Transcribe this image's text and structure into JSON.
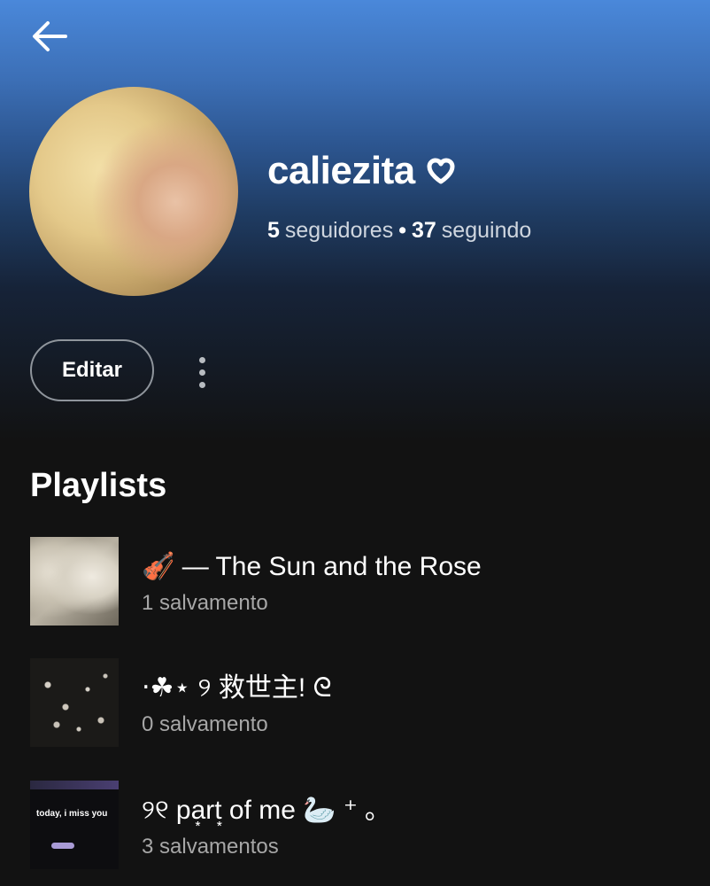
{
  "profile": {
    "name": "caliezita",
    "followers_count": "5",
    "followers_label": "seguidores",
    "separator": "•",
    "following_count": "37",
    "following_label": "seguindo"
  },
  "actions": {
    "edit_label": "Editar"
  },
  "playlists": {
    "section_title": "Playlists",
    "items": [
      {
        "title": "🎻 — The Sun and the Rose",
        "subtitle": "1 salvamento",
        "cover_text": ""
      },
      {
        "title": "‧☘︎⋆ ୨  救世主!  ᘓ",
        "subtitle": "0 salvamento",
        "cover_text": ""
      },
      {
        "title": "୨୧  pa͙rt͙ of me  🦢 ⁺ ｡",
        "subtitle": "3 salvamentos",
        "cover_text": "today, i miss you"
      }
    ]
  },
  "colors": {
    "gradient_top": "#4a88da",
    "background": "#121212",
    "subtitle_gray": "#a7a7a7"
  },
  "icons": {
    "back": "arrow-left-icon",
    "verified_heart": "heart-icon",
    "more": "more-vertical-icon"
  }
}
